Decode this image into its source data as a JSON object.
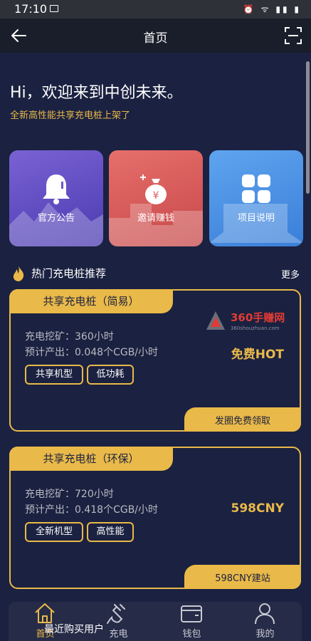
{
  "status": {
    "time": "17:10",
    "right_icons": "⏰ ᯤ ▮▮ ▮"
  },
  "nav": {
    "title": "首页"
  },
  "hero": {
    "greeting": "Hi，欢迎来到中创未来。",
    "subtitle": "全新高性能共享充电桩上架了"
  },
  "tiles": [
    {
      "label": "官方公告",
      "icon": "bell-icon",
      "color": "#6b56cc"
    },
    {
      "label": "邀请赚钱",
      "icon": "money-bag-icon",
      "color": "#dc5e5c"
    },
    {
      "label": "项目说明",
      "icon": "grid-icon",
      "color": "#4d93e5"
    }
  ],
  "section": {
    "title": "热门充电桩推荐",
    "more": "更多"
  },
  "cards": [
    {
      "title": "共享充电桩（简易）",
      "line1": "充电挖矿：360小时",
      "line2": "预计产出：0.048个CGB/小时",
      "price": "免费HOT",
      "tags": [
        "共享机型",
        "低功耗"
      ],
      "action": "发圈免费领取"
    },
    {
      "title": "共享充电桩（环保）",
      "line1": "充电挖矿：720小时",
      "line2": "预计产出：0.418个CGB/小时",
      "price": "598CNY",
      "tags": [
        "全新机型",
        "高性能"
      ],
      "action": "598CNY建站"
    }
  ],
  "watermark": {
    "title": "360手赚网",
    "sub": "360shouzhuan.com"
  },
  "bottom_nav": [
    {
      "label": "首页",
      "icon": "home-icon",
      "active": true
    },
    {
      "label": "充电",
      "icon": "plug-icon"
    },
    {
      "label": "钱包",
      "icon": "wallet-icon"
    },
    {
      "label": "我的",
      "icon": "user-icon"
    }
  ],
  "overlay": {
    "recent_buyers": "最近购买用户"
  },
  "colors": {
    "accent": "#e9b949",
    "background": "#1b2140",
    "nav_bg": "#262b47"
  }
}
